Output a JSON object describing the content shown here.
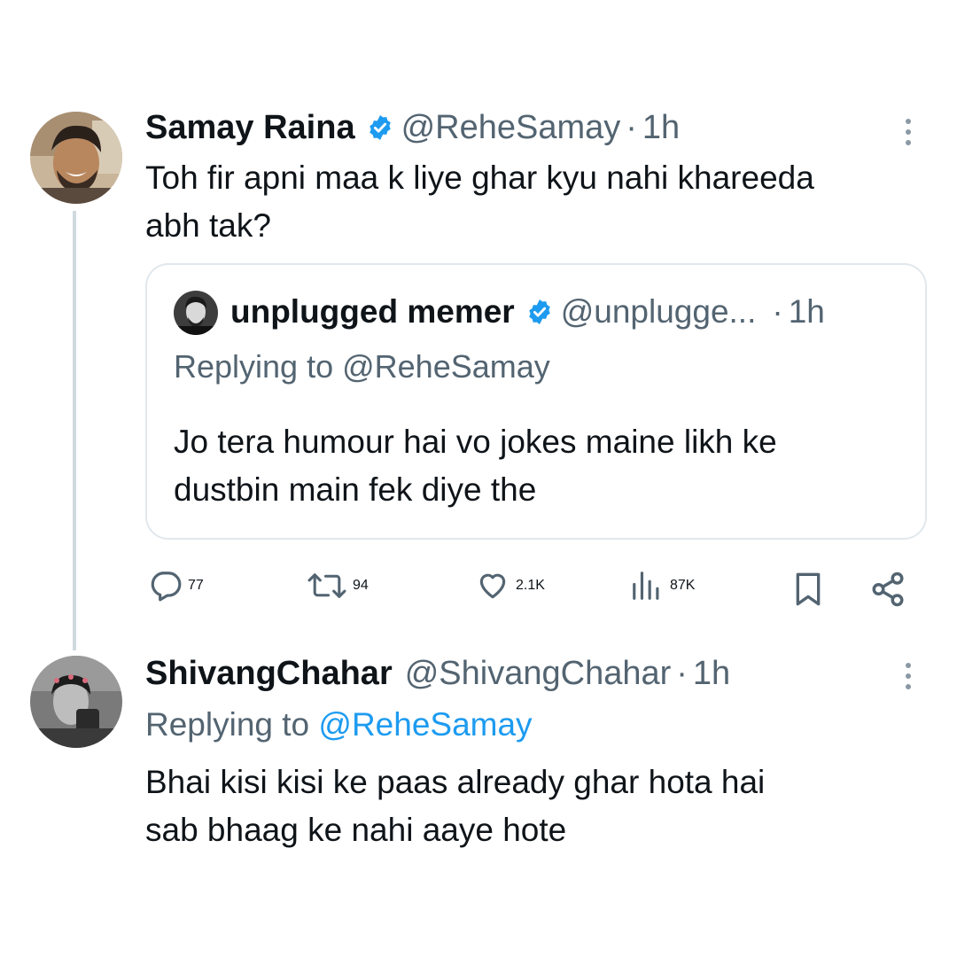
{
  "tweet": {
    "author_name": "Samay Raina",
    "author_handle": "@ReheSamay",
    "separator": "·",
    "time": "1h",
    "text_line1": "Toh fir apni maa k liye ghar kyu nahi khareeda",
    "text_line2": "abh tak?",
    "verified": true
  },
  "quoted_tweet": {
    "author_name": "unplugged memer",
    "author_handle": "@unplugge...",
    "separator": "·",
    "time": "1h",
    "replying_label": "Replying to @ReheSamay",
    "text_line1": "Jo tera humour hai vo jokes maine likh ke",
    "text_line2": "dustbin main fek diye the",
    "verified": true
  },
  "actions": {
    "replies": "77",
    "retweets": "94",
    "likes": "2.1K",
    "views": "87K"
  },
  "reply": {
    "author_name": "ShivangChahar",
    "author_handle": "@ShivangChahar",
    "separator": "·",
    "time": "1h",
    "replying_label": "Replying to",
    "replying_mention": "@ReheSamay",
    "text_line1": "Bhai kisi kisi ke paas already ghar hota hai",
    "text_line2": "sab bhaag ke nahi aaye hote"
  },
  "colors": {
    "verified_blue": "#1d9bf0",
    "secondary_text": "#536471",
    "mention": "#1d9bf0",
    "thread_line": "#cfd9de"
  },
  "icons": {
    "reply": "speech-bubble-icon",
    "retweet": "retweet-icon",
    "like": "heart-icon",
    "views": "bar-chart-icon",
    "bookmark": "bookmark-icon",
    "share": "share-icon",
    "more": "more-vertical-icon",
    "verified": "verified-badge-icon"
  }
}
